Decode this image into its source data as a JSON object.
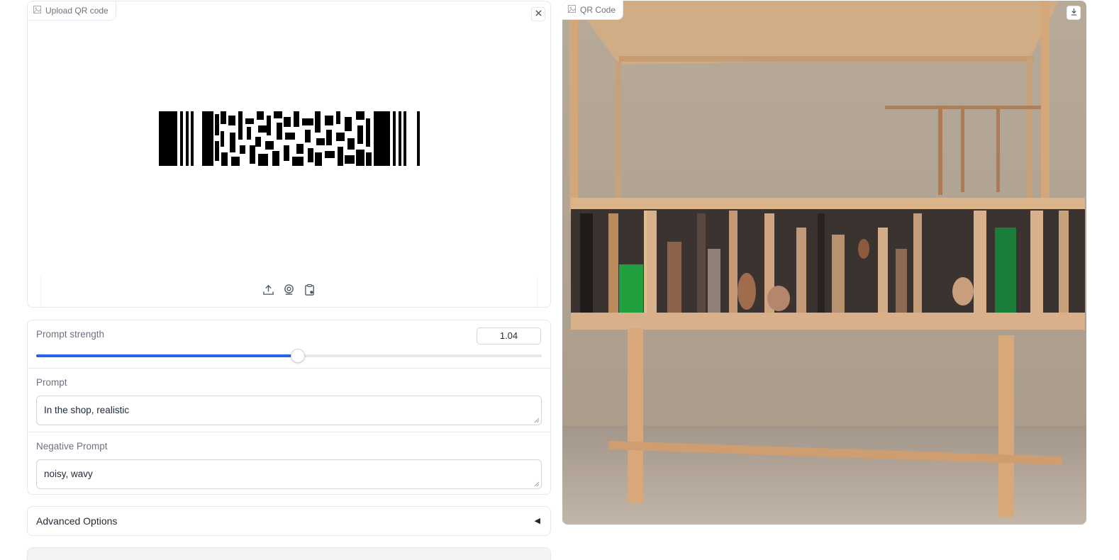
{
  "upload": {
    "label": "Upload QR code",
    "label_icon": "image-icon",
    "clear_icon": "close-icon",
    "sources": [
      "upload-icon",
      "webcam-icon",
      "clipboard-icon"
    ]
  },
  "controls": {
    "strength": {
      "label": "Prompt strength",
      "value": "1.04",
      "fraction": 0.517
    },
    "prompt": {
      "label": "Prompt",
      "value": "In the shop, realistic"
    },
    "negative_prompt": {
      "label": "Negative Prompt",
      "value": "noisy, wavy"
    }
  },
  "advanced": {
    "label": "Advanced Options",
    "arrow": "◀"
  },
  "output": {
    "label": "QR Code",
    "label_icon": "image-icon",
    "download_icon": "download-icon"
  },
  "colors": {
    "accent": "#2563eb",
    "border": "#e5e7eb"
  }
}
